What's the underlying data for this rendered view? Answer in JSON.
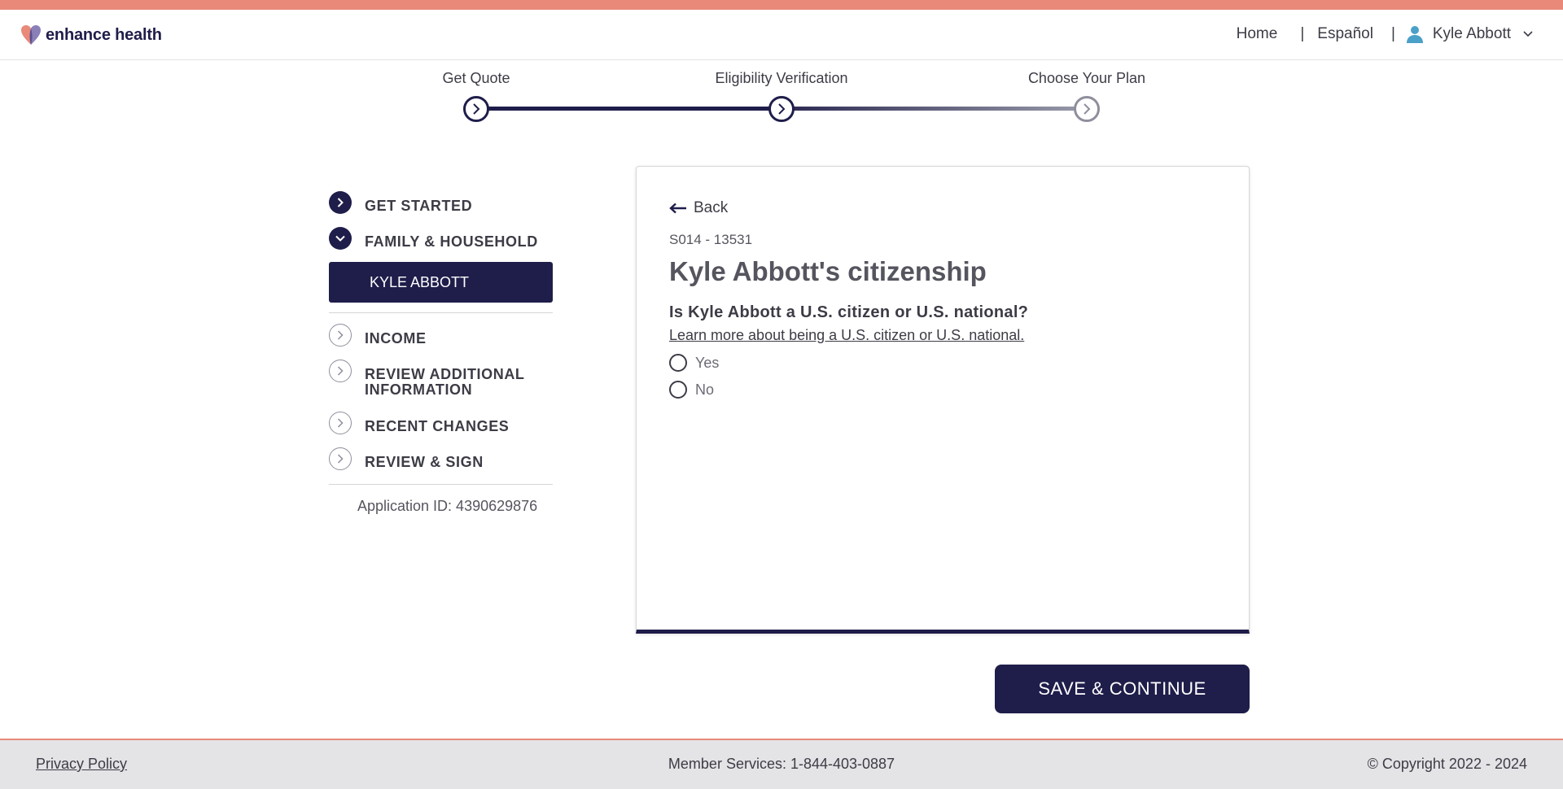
{
  "colors": {
    "accent_stripe": "#e8897a",
    "navy": "#1f1d4a",
    "footer_bg": "#e4e4e6"
  },
  "header": {
    "logo_text": "enhance health",
    "logo_icon": "heart-logo-icon",
    "nav": {
      "home": "Home",
      "separator": "|",
      "language": "Español",
      "user_name": "Kyle Abbott",
      "user_icon": "user-icon",
      "menu_icon": "chevron-down-icon"
    }
  },
  "tracker": {
    "steps": [
      {
        "label": "Get Quote",
        "state": "complete"
      },
      {
        "label": "Eligibility Verification",
        "state": "current"
      },
      {
        "label": "Choose Your Plan",
        "state": "upcoming"
      }
    ]
  },
  "sidebar": {
    "items": [
      {
        "label": "GET STARTED",
        "icon": "chevron-right-icon",
        "state": "complete"
      },
      {
        "label": "FAMILY & HOUSEHOLD",
        "icon": "chevron-down-icon",
        "state": "expanded"
      },
      {
        "label": "INCOME",
        "icon": "chevron-right-icon",
        "state": "upcoming"
      },
      {
        "label": "REVIEW ADDITIONAL INFORMATION",
        "icon": "chevron-right-icon",
        "state": "upcoming"
      },
      {
        "label": "RECENT CHANGES",
        "icon": "chevron-right-icon",
        "state": "upcoming"
      },
      {
        "label": "REVIEW & SIGN",
        "icon": "chevron-right-icon",
        "state": "upcoming"
      }
    ],
    "subitem": "KYLE ABBOTT",
    "application_id": "Application ID: 4390629876"
  },
  "card": {
    "back_label": "Back",
    "code": "S014 - 13531",
    "title": "Kyle Abbott's citizenship",
    "question": "Is Kyle Abbott a U.S. citizen or U.S. national?",
    "learn_more": "Learn more about being a U.S. citizen or U.S. national.",
    "options": [
      "Yes",
      "No"
    ]
  },
  "actions": {
    "save_label": "SAVE & CONTINUE"
  },
  "footer": {
    "privacy": "Privacy Policy",
    "member_services": "Member Services: 1-844-403-0887",
    "copyright": "© Copyright 2022 - 2024"
  }
}
